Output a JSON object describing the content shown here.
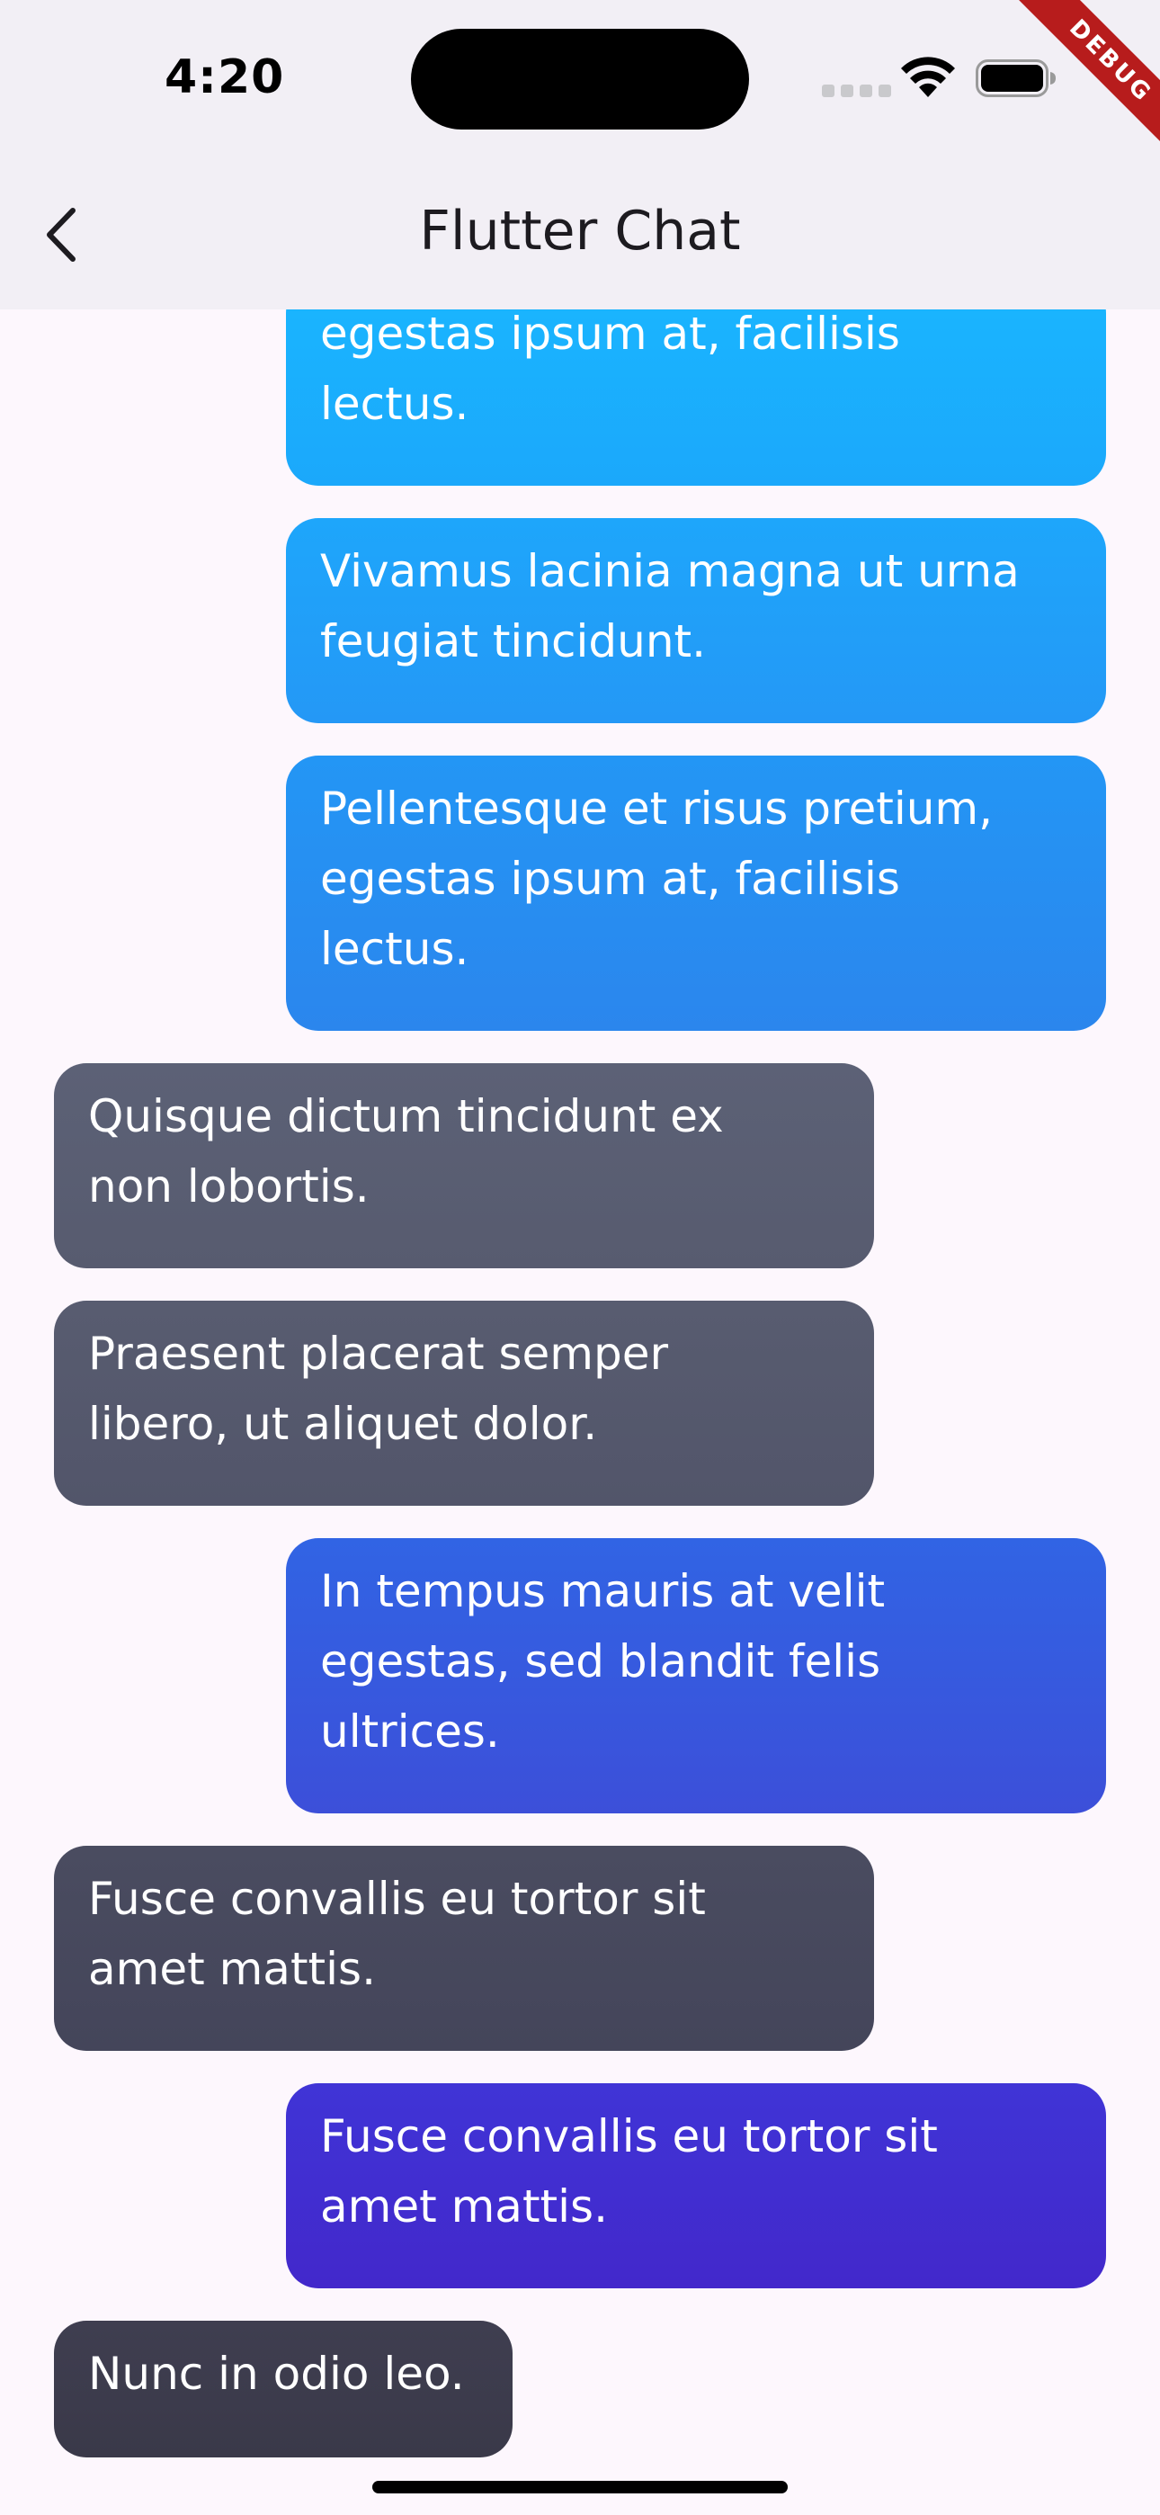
{
  "status_bar": {
    "time": "4:20",
    "debug_label": "DEBUG"
  },
  "app_bar": {
    "title": "Flutter Chat",
    "back_icon": "chevron-left-icon"
  },
  "colors": {
    "app_bar_bg": "#f2eff5",
    "page_bg": "#fdf7fd",
    "incoming_bubble": "#565a6e",
    "outgoing_gradient_start": "#1ab6ff",
    "outgoing_gradient_end": "#3f2bd0"
  },
  "messages": [
    {
      "direction": "outgoing",
      "text": "egestas ipsum at, facilisis\nlectus."
    },
    {
      "direction": "outgoing",
      "text": "Vivamus lacinia magna ut urna\nfeugiat tincidunt."
    },
    {
      "direction": "outgoing",
      "text": "Pellentesque et risus pretium,\negestas ipsum at, facilisis\nlectus."
    },
    {
      "direction": "incoming",
      "text": "Quisque dictum tincidunt ex\nnon lobortis."
    },
    {
      "direction": "incoming",
      "text": "Praesent placerat semper\nlibero, ut aliquet dolor."
    },
    {
      "direction": "outgoing",
      "text": "In tempus mauris at velit\negestas, sed blandit felis\nultrices."
    },
    {
      "direction": "incoming",
      "text": "Fusce convallis eu tortor sit\namet mattis."
    },
    {
      "direction": "outgoing",
      "text": "Fusce convallis eu tortor sit\namet mattis."
    },
    {
      "direction": "incoming",
      "text": "Nunc in odio leo."
    }
  ]
}
